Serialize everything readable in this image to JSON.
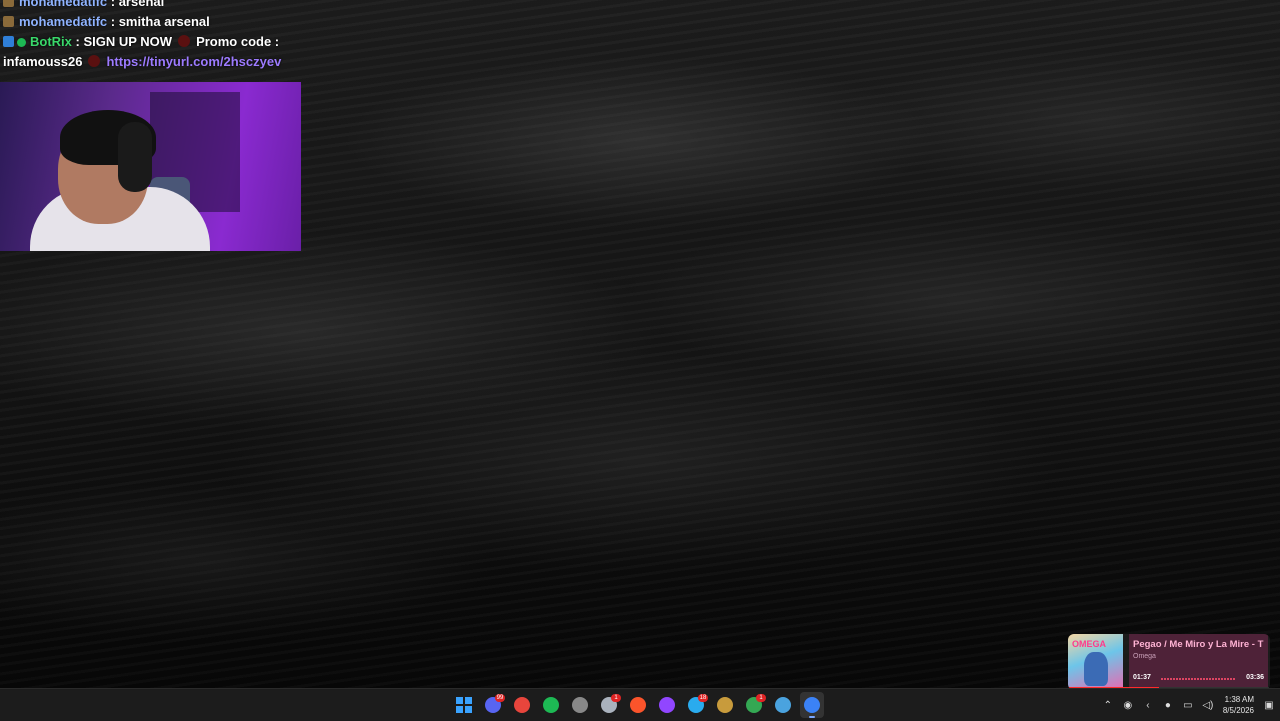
{
  "chat": {
    "lines": [
      {
        "user": "mohamedatifc",
        "sep": " : ",
        "message": "arsenal"
      },
      {
        "user": "mohamedatifc",
        "sep": " : ",
        "message": "smitha arsenal"
      },
      {
        "user": "BotRix",
        "sep": " : ",
        "message": "SIGN UP NOW",
        "message2": "Promo code :",
        "message3": "infamouss26",
        "link": "https://tinyurl.com/2hsczyev"
      }
    ]
  },
  "music": {
    "title": "Pegao / Me Miro y La Mire - T",
    "artist": "Omega",
    "album_art_text": "OMEGA",
    "current_time": "01:37",
    "total_time": "03:36",
    "progress": 0.45
  },
  "taskbar": {
    "apps": [
      {
        "icon": "windows-start-icon",
        "color": "#3aa3ff"
      },
      {
        "icon": "discord-icon",
        "color": "#5865f2",
        "badge": "99"
      },
      {
        "icon": "chrome-icon",
        "color": "#e8453c"
      },
      {
        "icon": "spotify-icon",
        "color": "#1db954"
      },
      {
        "icon": "obs-icon",
        "color": "#888888"
      },
      {
        "icon": "steam-icon",
        "color": "#aab2bd",
        "badge": "1"
      },
      {
        "icon": "brave-icon",
        "color": "#fb542b"
      },
      {
        "icon": "twitch-icon",
        "color": "#9146ff"
      },
      {
        "icon": "telegram-icon",
        "color": "#2aabee",
        "badge": "18"
      },
      {
        "icon": "league-icon",
        "color": "#c89b3c"
      },
      {
        "icon": "chrome-profile-icon",
        "color": "#34a853",
        "badge": "1"
      },
      {
        "icon": "mail-icon",
        "color": "#4aa3df"
      },
      {
        "icon": "app-icon",
        "color": "#3b82f6"
      }
    ],
    "clock_time": "1:38 AM",
    "clock_date": "8/5/2026"
  }
}
